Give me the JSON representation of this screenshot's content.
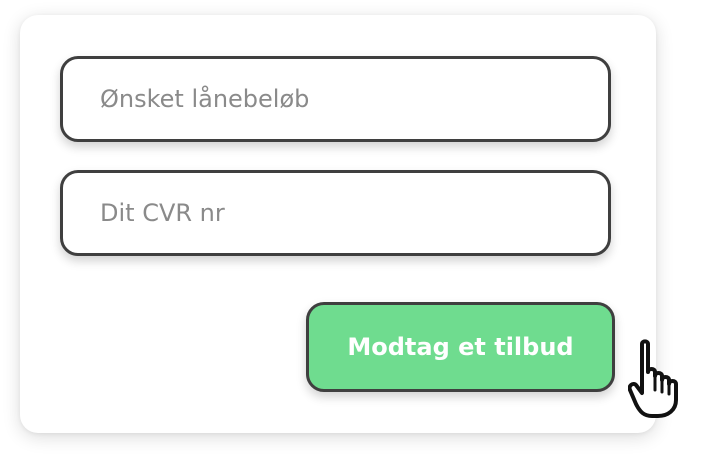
{
  "form": {
    "amount_placeholder": "Ønsket lånebeløb",
    "amount_value": "",
    "cvr_placeholder": "Dit CVR nr",
    "cvr_value": "",
    "submit_label": "Modtag et tilbud"
  },
  "cursor": {
    "icon": "hand-pointer-icon"
  },
  "colors": {
    "button_bg": "#6fdc8f",
    "border": "#3f3f3f",
    "placeholder": "#8a8a8a",
    "button_text": "#ffffff"
  }
}
